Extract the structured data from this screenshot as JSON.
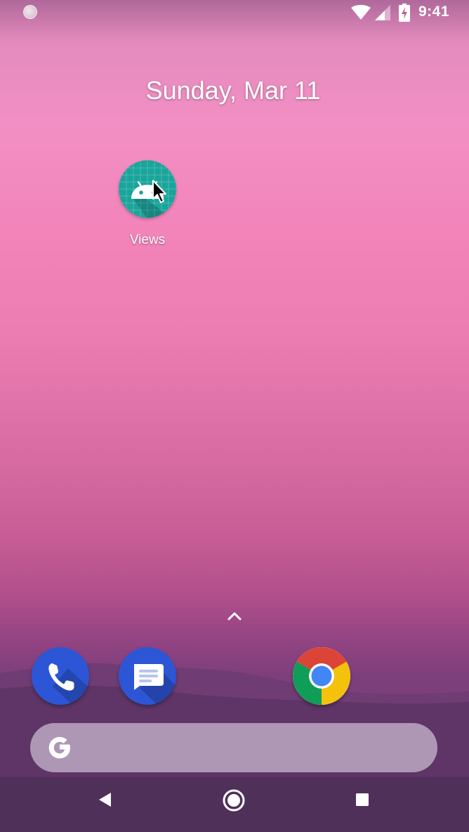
{
  "status_bar": {
    "time": "9:41",
    "icons": [
      "notification-dot-icon",
      "wifi-icon",
      "cellular-signal-icon",
      "battery-charging-icon"
    ]
  },
  "home": {
    "date": "Sunday, Mar 11",
    "apps": [
      {
        "label": "Views",
        "icon": "android-robot-icon"
      }
    ]
  },
  "drawer": {
    "icon": "chevron-up-icon"
  },
  "dock": {
    "apps": [
      {
        "name": "Phone",
        "icon": "phone-icon"
      },
      {
        "name": "Messages",
        "icon": "messages-icon"
      },
      {
        "name": "Chrome",
        "icon": "chrome-icon"
      }
    ]
  },
  "search": {
    "icon": "google-g-icon",
    "placeholder": ""
  },
  "nav_bar": {
    "buttons": [
      "back-icon",
      "home-icon",
      "recents-icon"
    ]
  },
  "colors": {
    "wallpaper_top": "#f38fc4",
    "wallpaper_bottom": "#7d3f7c",
    "app_icon_teal": "#1aa59b",
    "dock_blue": "#2d56d6",
    "chrome_red": "#db4437",
    "chrome_yellow": "#f4c20d",
    "chrome_green": "#0f9d58",
    "chrome_blue": "#4285f4"
  }
}
